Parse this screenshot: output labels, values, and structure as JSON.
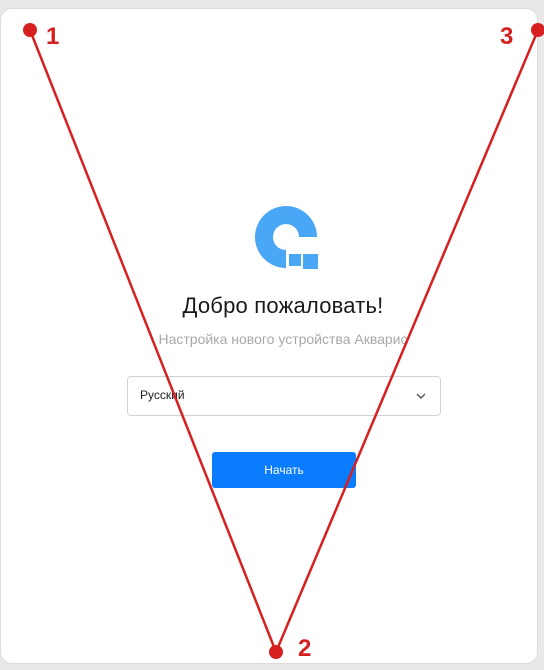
{
  "welcome": {
    "title": "Добро пожаловать!",
    "subtitle": "Настройка нового устройства Акварис"
  },
  "language_select": {
    "selected": "Русский",
    "icon": "chevron-down-icon"
  },
  "start_button": {
    "label": "Начать"
  },
  "annotations": {
    "markers": [
      "1",
      "2",
      "3"
    ],
    "color": "#d62020"
  },
  "colors": {
    "accent": "#0a7cff",
    "logo": "#4aa7f5"
  }
}
